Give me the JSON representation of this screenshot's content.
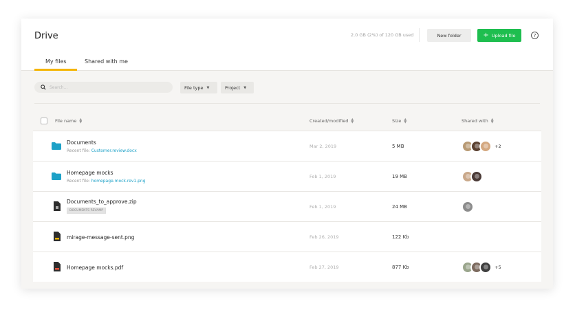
{
  "header": {
    "title": "Drive",
    "storage": "2.0 GB (2%) of 120 GB used",
    "new_folder_label": "New folder",
    "upload_label": "Upload file",
    "help_icon": "help-circle-icon",
    "help_glyph": "?"
  },
  "tabs": [
    {
      "label": "My files",
      "active": true
    },
    {
      "label": "Shared with me",
      "active": false
    }
  ],
  "search": {
    "placeholder": "Search..."
  },
  "filters": [
    {
      "label": "File type"
    },
    {
      "label": "Project"
    }
  ],
  "table": {
    "columns": [
      "File name",
      "Created/modified",
      "Size",
      "Shared with"
    ],
    "rows": [
      {
        "name": "Documents",
        "type": "folder",
        "recent_prefix": "Recent file: ",
        "recent_file": "Customer.review.docx",
        "date": "Mar 2, 2019",
        "size": "5 MB",
        "avatar_colors": [
          "#b89a74",
          "#5a4030",
          "#d4a880"
        ],
        "more": "+2"
      },
      {
        "name": "Homepage mocks",
        "type": "folder",
        "recent_prefix": "Recent file: ",
        "recent_file": "homepage.mock.rev1.png",
        "date": "Feb 1, 2019",
        "size": "19 MB",
        "avatar_colors": [
          "#c9a88a",
          "#4a3a36"
        ],
        "more": ""
      },
      {
        "name": "Documents_to_approve.zip",
        "type": "file",
        "tag": "DOCUMENTS REVAMP",
        "date": "Feb 1, 2019",
        "size": "24 MB",
        "avatar_colors": [
          "#8c8c8c"
        ],
        "more": ""
      },
      {
        "name": "mirage-message-sent.png",
        "type": "file",
        "date": "Feb 26, 2019",
        "size": "122 Kb",
        "avatar_colors": [],
        "more": ""
      },
      {
        "name": "Homepage mocks.pdf",
        "type": "file",
        "date": "Feb 27, 2019",
        "size": "877 Kb",
        "avatar_colors": [
          "#9aa58c",
          "#7c6a5e",
          "#3f3f3f"
        ],
        "more": "+5"
      }
    ]
  },
  "colors": {
    "accent": "#f4b400",
    "primary_button": "#1ebe4f",
    "folder": "#1da1c7",
    "link": "#1da1c7"
  }
}
